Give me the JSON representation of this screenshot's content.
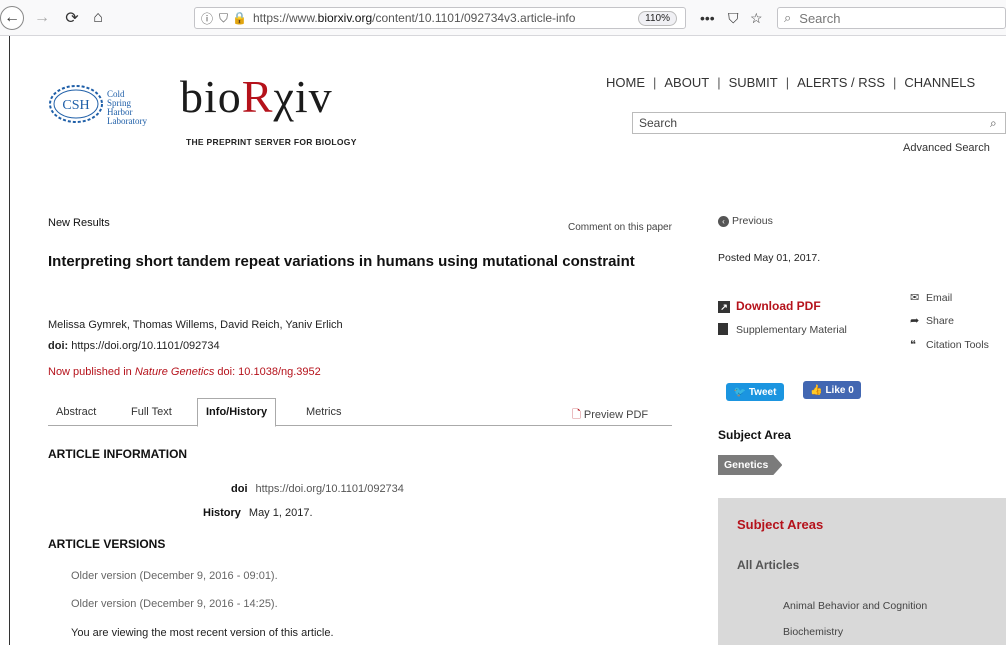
{
  "browser": {
    "url_prefix": "https://www.",
    "url_domain": "biorxiv.org",
    "url_path": "/content/10.1101/092734v3.article-info",
    "zoom": "110%",
    "search_placeholder": "Search"
  },
  "header": {
    "csh_line1": "Cold",
    "csh_line2": "Spring",
    "csh_line3": "Harbor",
    "csh_line4": "Laboratory",
    "csh_mark": "CSH",
    "logo_part1": "bio",
    "logo_part2": "R",
    "logo_part3": "χiv",
    "tagline": "THE PREPRINT SERVER FOR BIOLOGY",
    "nav": [
      "HOME",
      "ABOUT",
      "SUBMIT",
      "ALERTS / RSS",
      "CHANNELS"
    ],
    "search_placeholder": "Search",
    "advanced_search": "Advanced Search"
  },
  "article": {
    "category": "New Results",
    "comment_link": "Comment on this paper",
    "title": "Interpreting short tandem repeat variations in humans using mutational constraint",
    "authors": "Melissa Gymrek, Thomas Willems, David Reich, Yaniv Erlich",
    "doi_label": "doi:",
    "doi_value": "https://doi.org/10.1101/092734",
    "published_prefix": "Now published in ",
    "published_journal": "Nature Genetics",
    "published_suffix": " doi: 10.1038/ng.3952",
    "tabs": [
      "Abstract",
      "Full Text",
      "Info/History",
      "Metrics"
    ],
    "preview_pdf": "Preview PDF",
    "info_heading": "ARTICLE INFORMATION",
    "info_doi_label": "doi",
    "info_doi_value": "https://doi.org/10.1101/092734",
    "info_history_label": "History",
    "info_history_value": "May 1, 2017.",
    "versions_heading": "ARTICLE VERSIONS",
    "versions": [
      "Older version (December 9, 2016 - 09:01).",
      "Older version (December 9, 2016 - 14:25)."
    ],
    "current_version": "You are viewing the most recent version of this article."
  },
  "sidebar": {
    "previous": "Previous",
    "posted": "Posted May 01, 2017.",
    "download_pdf": "Download PDF",
    "supplementary": "Supplementary Material",
    "email": "Email",
    "share": "Share",
    "citation_tools": "Citation Tools",
    "tweet": "Tweet",
    "like": "Like 0",
    "subject_heading": "Subject Area",
    "subject_tag": "Genetics",
    "areas_title": "Subject Areas",
    "all_articles": "All Articles",
    "areas": [
      "Animal Behavior and Cognition",
      "Biochemistry"
    ]
  }
}
